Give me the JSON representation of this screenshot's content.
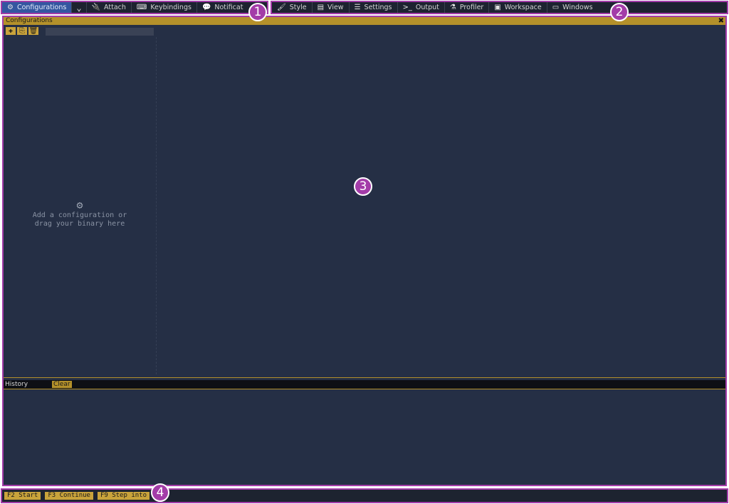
{
  "toolbar_left": {
    "items": [
      {
        "label": "Configurations",
        "icon": "gears-icon",
        "glyph": "⚙",
        "active": true
      },
      {
        "label": "Attach",
        "icon": "plug-icon",
        "glyph": "🔌"
      },
      {
        "label": "Keybindings",
        "icon": "keyboard-icon",
        "glyph": "⌨"
      },
      {
        "label": "Notificat",
        "icon": "comments-icon",
        "glyph": "💬"
      }
    ],
    "dropdown_icon": "chevron-down-icon"
  },
  "toolbar_right": {
    "items": [
      {
        "label": "Style",
        "icon": "brush-icon",
        "glyph": "🖌"
      },
      {
        "label": "View",
        "icon": "view-icon",
        "glyph": "▤"
      },
      {
        "label": "Settings",
        "icon": "sliders-icon",
        "glyph": "☰"
      },
      {
        "label": "Output",
        "icon": "terminal-icon",
        "glyph": ">_"
      },
      {
        "label": "Profiler",
        "icon": "flask-icon",
        "glyph": "⚗"
      },
      {
        "label": "Workspace",
        "icon": "workspace-icon",
        "glyph": "▣"
      },
      {
        "label": "Windows",
        "icon": "window-icon",
        "glyph": "▭"
      }
    ]
  },
  "panel": {
    "title": "Configurations",
    "close_glyph": "✖",
    "toolbar": [
      {
        "name": "add-config-button",
        "icon": "plus-icon",
        "glyph": "✚"
      },
      {
        "name": "duplicate-config-button",
        "icon": "copy-icon",
        "glyph": "⎘"
      },
      {
        "name": "delete-config-button",
        "icon": "trash-icon",
        "glyph": "🗑"
      }
    ],
    "empty_hint": {
      "icon": "gears-icon",
      "glyph": "⚙",
      "line1": "Add a configuration or",
      "line2": "drag your binary here"
    }
  },
  "history": {
    "label": "History",
    "clear_label": "Clear"
  },
  "status_bar": {
    "buttons": [
      {
        "label": "F2 Start"
      },
      {
        "label": "F3 Continue"
      },
      {
        "label": "F9 Step into"
      }
    ]
  },
  "badges": [
    "1",
    "2",
    "3",
    "4"
  ],
  "colors": {
    "accent_border": "#a33ca8",
    "panel_bg": "#252f45",
    "toolbar_bg": "#1d2330",
    "gold": "#b4912a",
    "active_tab": "#3456a0"
  }
}
